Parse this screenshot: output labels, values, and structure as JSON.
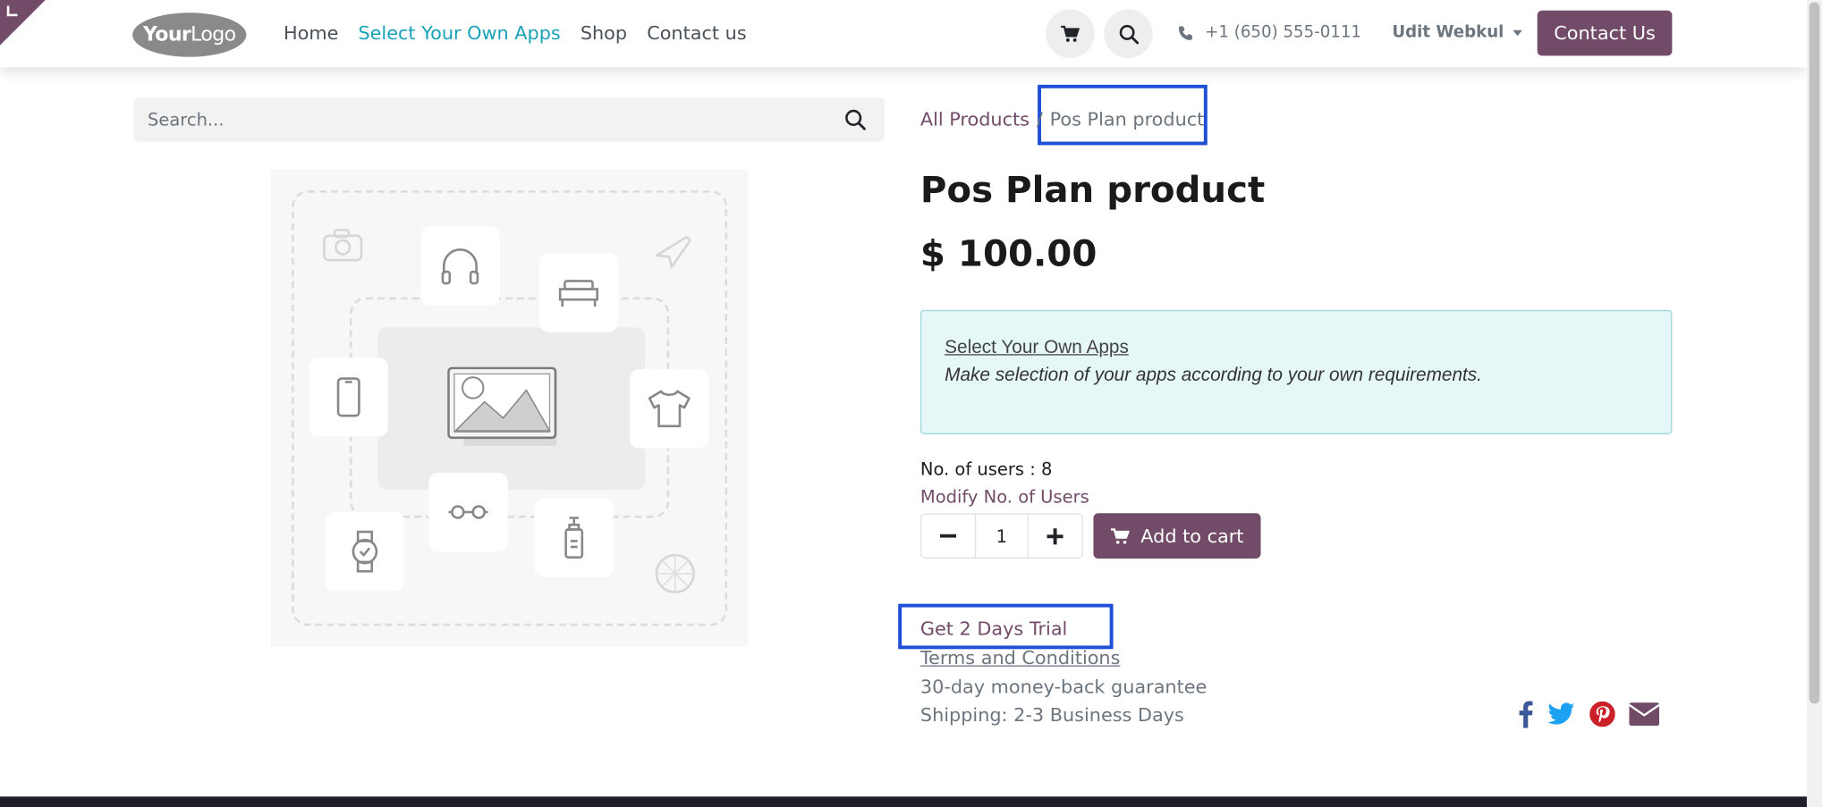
{
  "header": {
    "logo": {
      "bold": "Your",
      "rest": "Logo"
    },
    "nav": [
      "Home",
      "Select Your Own Apps",
      "Shop",
      "Contact us"
    ],
    "phone": "+1 (650) 555-0111",
    "user": "Udit Webkul",
    "contact_button": "Contact Us"
  },
  "search": {
    "placeholder": "Search..."
  },
  "breadcrumb": {
    "parent": "All Products",
    "separator": "/",
    "current": "Pos Plan product"
  },
  "product": {
    "title": "Pos Plan product",
    "price": "$ 100.00",
    "info_link": "Select Your Own Apps",
    "info_desc": "Make selection of your apps according to your own requirements.",
    "users_label": "No. of users : 8",
    "modify_label": "Modify No. of Users",
    "quantity": "1",
    "add_to_cart": "Add to cart",
    "trial": "Get 2 Days Trial",
    "terms": "Terms and Conditions",
    "guarantee": "30-day money-back guarantee",
    "shipping": "Shipping: 2-3 Business Days"
  },
  "colors": {
    "brand": "#714b67",
    "active_nav": "#17a2b8",
    "highlight": "#1e4fd6",
    "info_bg": "#e6f7f7"
  },
  "social_icons": [
    "facebook-icon",
    "twitter-icon",
    "pinterest-icon",
    "email-icon"
  ]
}
